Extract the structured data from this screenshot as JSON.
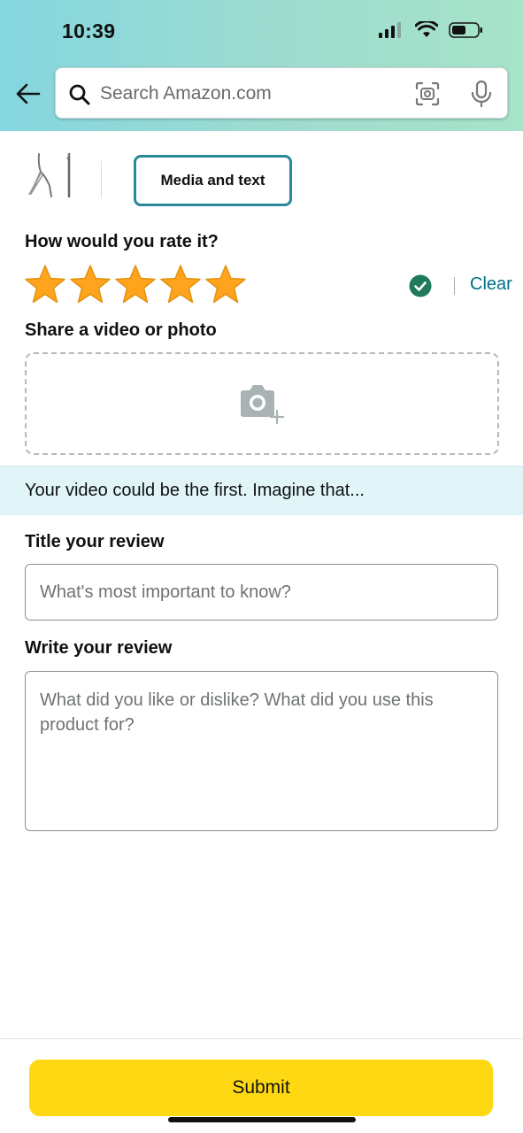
{
  "status_bar": {
    "time": "10:39",
    "icons": [
      "cellular-signal-icon",
      "wifi-icon",
      "battery-icon"
    ]
  },
  "header": {
    "back_icon": "arrow-left-icon",
    "search": {
      "placeholder": "Search Amazon.com",
      "icons": [
        "search-icon",
        "camera-scan-icon",
        "microphone-icon"
      ]
    }
  },
  "tabs": {
    "active_label": "Media and text"
  },
  "rating": {
    "label": "How would you rate it?",
    "stars_selected": 5,
    "stars_total": 5,
    "clear_label": "Clear"
  },
  "media": {
    "label": "Share a video or photo",
    "icon": "camera-add-icon"
  },
  "banner": {
    "text": "Your video could be the first. Imagine that..."
  },
  "review_title": {
    "label": "Title your review",
    "placeholder": "What's most important to know?"
  },
  "review_body": {
    "label": "Write your review",
    "placeholder": "What did you like or dislike? What did you use this product for?"
  },
  "submit": {
    "label": "Submit"
  },
  "colors": {
    "accent_teal": "#2a8a9a",
    "link": "#007185",
    "star": "#ffa41c",
    "submit_yellow": "#ffd814",
    "check_green": "#1f7a5a",
    "banner_bg": "#e1f5f8"
  }
}
